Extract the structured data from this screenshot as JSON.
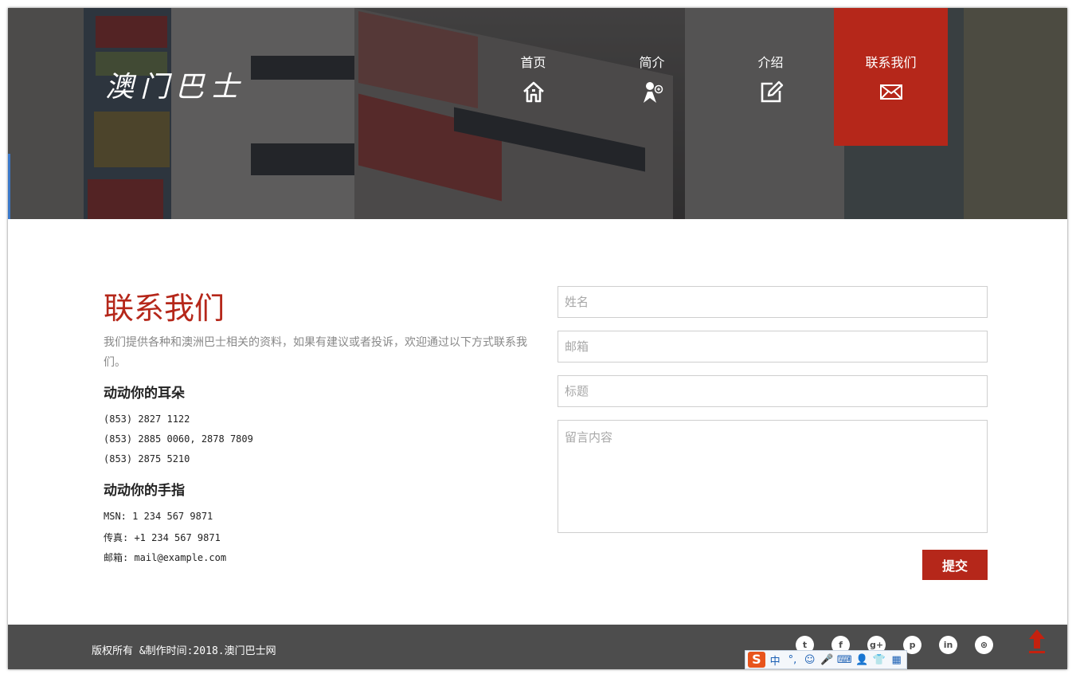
{
  "header": {
    "logo": "澳门巴士",
    "nav": [
      {
        "label": "首页",
        "icon": "home-icon"
      },
      {
        "label": "简介",
        "icon": "person-icon"
      },
      {
        "label": "介绍",
        "icon": "edit-icon"
      },
      {
        "label": "联系我们",
        "icon": "mail-icon",
        "active": true
      }
    ],
    "active_color": "#b5271a"
  },
  "contact": {
    "title": "联系我们",
    "intro": "我们提供各种和澳洲巴士相关的资料，如果有建议或者投诉，欢迎通过以下方式联系我们。",
    "ears_heading": "动动你的耳朵",
    "phones": [
      "(853) 2827 1122",
      "(853) 2885 0060, 2878 7809",
      "(853) 2875 5210"
    ],
    "fingers_heading": "动动你的手指",
    "msn": "MSN: 1 234 567 9871",
    "fax": "传真: +1 234 567 9871",
    "email": "邮箱: mail@example.com"
  },
  "form": {
    "name_placeholder": "姓名",
    "email_placeholder": "邮箱",
    "title_placeholder": "标题",
    "message_placeholder": "留言内容",
    "submit_label": "提交"
  },
  "footer": {
    "copyright": "版权所有 &制作时间:2018.澳门巴士网",
    "social": [
      {
        "icon": "twitter-icon",
        "glyph": "t"
      },
      {
        "icon": "facebook-icon",
        "glyph": "f"
      },
      {
        "icon": "google-plus-icon",
        "glyph": "g+"
      },
      {
        "icon": "pinterest-icon",
        "glyph": "p"
      },
      {
        "icon": "linkedin-icon",
        "glyph": "in"
      },
      {
        "icon": "dribbble-icon",
        "glyph": "⊛"
      }
    ],
    "background": "#4d4d4d"
  },
  "ime_toolbar": {
    "logo": "S",
    "mode": "中",
    "items": [
      "°,",
      "☺",
      "🎤",
      "⌨",
      "👤",
      "👕",
      "▦"
    ]
  }
}
